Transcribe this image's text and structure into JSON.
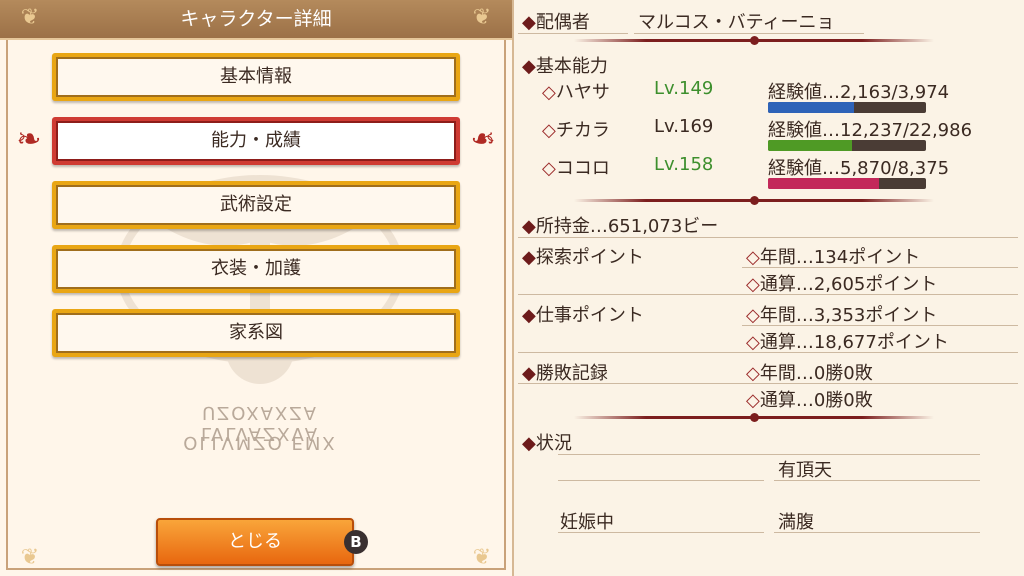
{
  "header": {
    "title": "キャラクター詳細"
  },
  "menu": {
    "items": [
      {
        "label": "基本情報"
      },
      {
        "label": "能力・成績"
      },
      {
        "label": "武術設定"
      },
      {
        "label": "衣装・加護"
      },
      {
        "label": "家系図"
      }
    ],
    "selected_index": 1
  },
  "close_button": {
    "label": "とじる",
    "key_hint": "B"
  },
  "watermark": {
    "line1": "LVLVAZXVA UZOXAXZA",
    "line2": "OLLVMZO EMX"
  },
  "details": {
    "spouse_label": "配偶者",
    "spouse_name": "マルコス・バティーニョ",
    "abilities_label": "基本能力",
    "abilities": [
      {
        "name": "ハヤサ",
        "level": "Lv.149",
        "exp": "経験値…2,163/3,974",
        "ratio": 0.544,
        "bar_color": "#2e63b8",
        "level_color": "#3d8f2d"
      },
      {
        "name": "チカラ",
        "level": "Lv.169",
        "exp": "経験値…12,237/22,986",
        "ratio": 0.532,
        "bar_color": "#4f9a25",
        "level_color": "#3b2a22"
      },
      {
        "name": "ココロ",
        "level": "Lv.158",
        "exp": "経験値…5,870/8,375",
        "ratio": 0.701,
        "bar_color": "#c3285a",
        "level_color": "#3d8f2d"
      }
    ],
    "money": "所持金…651,073ビー",
    "explore_label": "探索ポイント",
    "explore_year": "年間…134ポイント",
    "explore_total": "通算…2,605ポイント",
    "work_label": "仕事ポイント",
    "work_year": "年間…3,353ポイント",
    "work_total": "通算…18,677ポイント",
    "record_label": "勝敗記録",
    "record_year": "年間…0勝0敗",
    "record_total": "通算…0勝0敗",
    "status_label": "状況",
    "status_items": [
      "有頂天",
      "妊娠中",
      "満腹"
    ]
  }
}
